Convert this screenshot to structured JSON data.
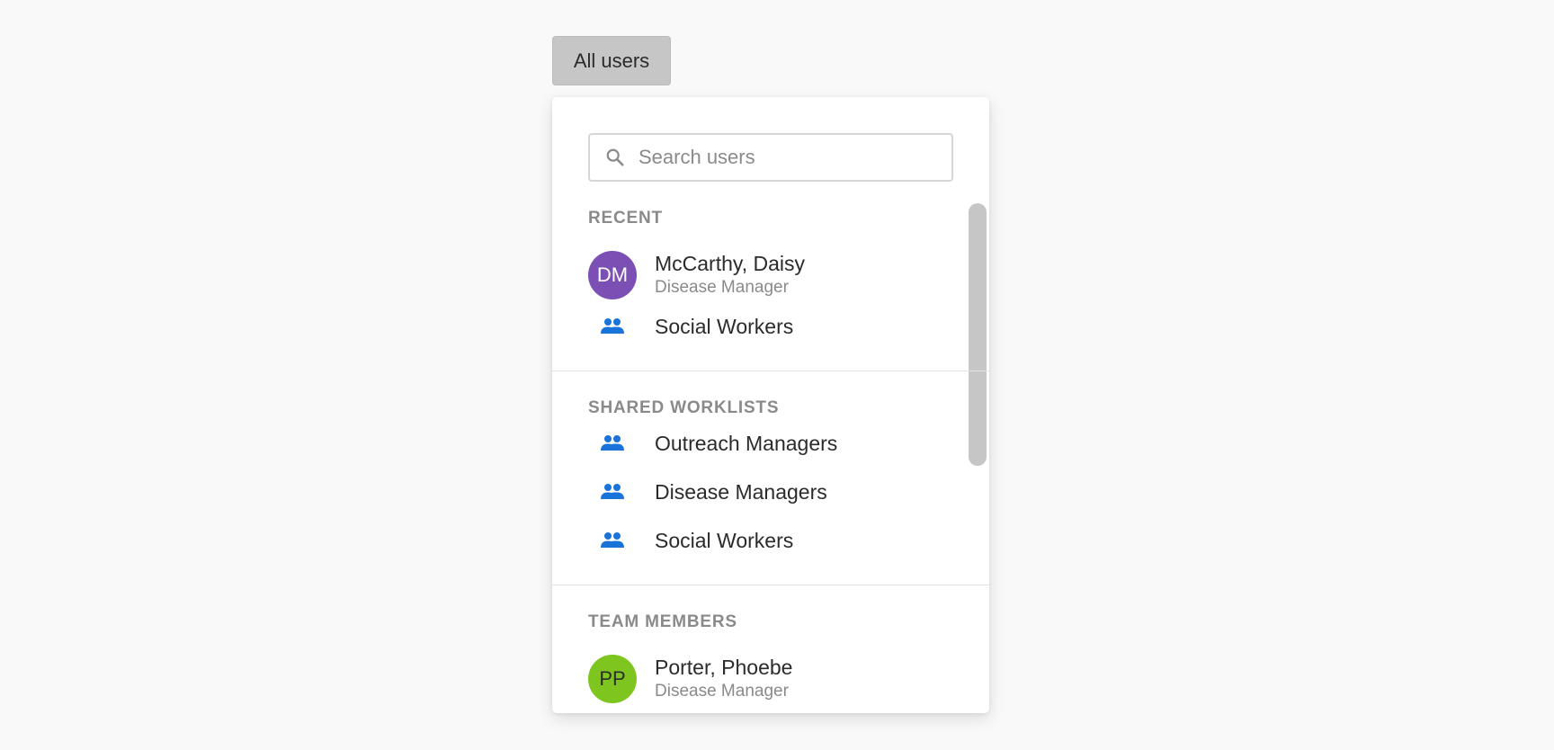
{
  "trigger": {
    "label": "All users"
  },
  "search": {
    "placeholder": "Search users",
    "value": "",
    "icon": "search-icon"
  },
  "sections": {
    "recent": {
      "header": "RECENT",
      "items": [
        {
          "type": "user",
          "initials": "DM",
          "name": "McCarthy, Daisy",
          "role": "Disease Manager",
          "color": "#7b4fb3"
        },
        {
          "type": "group",
          "name": "Social Workers",
          "icon": "group-icon"
        }
      ]
    },
    "shared": {
      "header": "SHARED WORKLISTS",
      "items": [
        {
          "type": "group",
          "name": "Outreach Managers",
          "icon": "group-icon"
        },
        {
          "type": "group",
          "name": "Disease Managers",
          "icon": "group-icon"
        },
        {
          "type": "group",
          "name": "Social Workers",
          "icon": "group-icon"
        }
      ]
    },
    "team": {
      "header": "TEAM MEMBERS",
      "items": [
        {
          "type": "user",
          "initials": "PP",
          "name": "Porter, Phoebe",
          "role": "Disease Manager",
          "color": "#7ec61f"
        }
      ]
    }
  },
  "colors": {
    "accent_icon": "#1a73d9",
    "header_text": "#8a8a8a",
    "avatar_dm": "#7b4fb3",
    "avatar_pp": "#7ec61f"
  }
}
